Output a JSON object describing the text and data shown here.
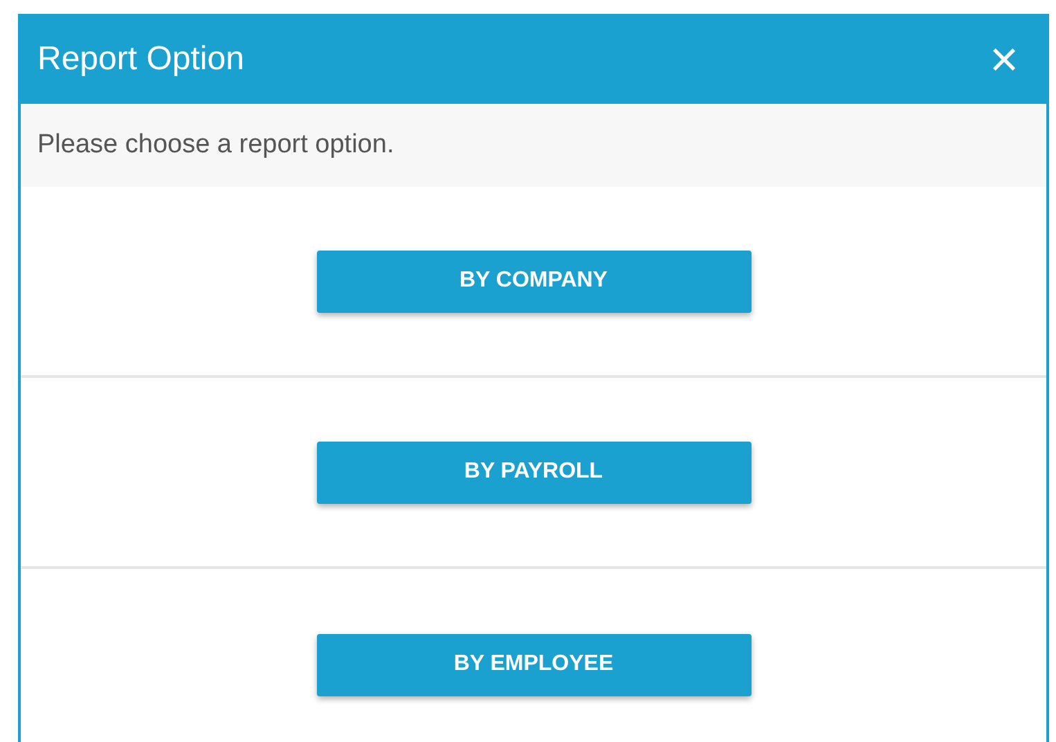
{
  "dialog": {
    "title": "Report Option",
    "close": "×",
    "message": "Please choose a report option.",
    "options": [
      {
        "label": "BY COMPANY"
      },
      {
        "label": "BY PAYROLL"
      },
      {
        "label": "BY EMPLOYEE"
      }
    ]
  }
}
